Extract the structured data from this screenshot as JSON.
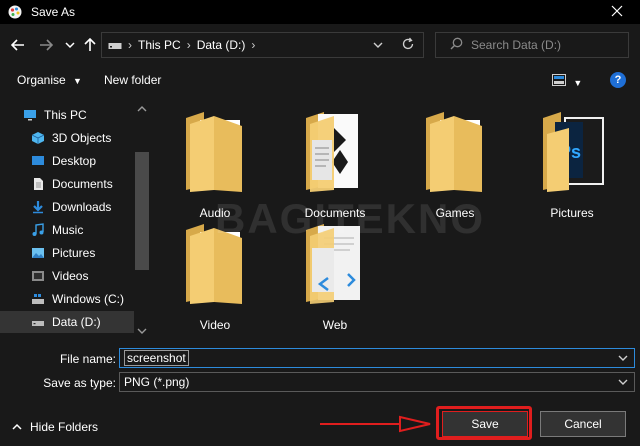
{
  "window": {
    "title": "Save As"
  },
  "address": {
    "path": [
      "This PC",
      "Data (D:)"
    ]
  },
  "search": {
    "placeholder": "Search Data (D:)"
  },
  "toolbar": {
    "organise_label": "Organise",
    "new_folder_label": "New folder"
  },
  "sidebar": {
    "items": [
      {
        "label": "This PC",
        "icon": "pc-icon"
      },
      {
        "label": "3D Objects",
        "icon": "cube-icon"
      },
      {
        "label": "Desktop",
        "icon": "desktop-icon"
      },
      {
        "label": "Documents",
        "icon": "document-icon"
      },
      {
        "label": "Downloads",
        "icon": "download-icon"
      },
      {
        "label": "Music",
        "icon": "music-icon"
      },
      {
        "label": "Pictures",
        "icon": "pictures-icon"
      },
      {
        "label": "Videos",
        "icon": "video-icon"
      },
      {
        "label": "Windows (C:)",
        "icon": "drive-windows-icon"
      },
      {
        "label": "Data (D:)",
        "icon": "drive-icon",
        "selected": true
      }
    ]
  },
  "folders": [
    {
      "label": "Audio",
      "icon": "folder-icon"
    },
    {
      "label": "Documents",
      "icon": "folder-documents-icon"
    },
    {
      "label": "Games",
      "icon": "folder-icon"
    },
    {
      "label": "Pictures",
      "icon": "folder-photoshop-icon"
    },
    {
      "label": "Video",
      "icon": "folder-icon"
    },
    {
      "label": "Web",
      "icon": "folder-vscode-icon"
    }
  ],
  "watermark": "BAGITEKNO",
  "form": {
    "file_name_label": "File name:",
    "file_name_value": "screenshot",
    "save_type_label": "Save as type:",
    "save_type_value": "PNG (*.png)"
  },
  "footer": {
    "hide_folders_label": "Hide Folders",
    "save_label": "Save",
    "cancel_label": "Cancel"
  },
  "colors": {
    "background": "#191919",
    "highlight": "#e01e1e",
    "accent": "#1f6fd6"
  }
}
